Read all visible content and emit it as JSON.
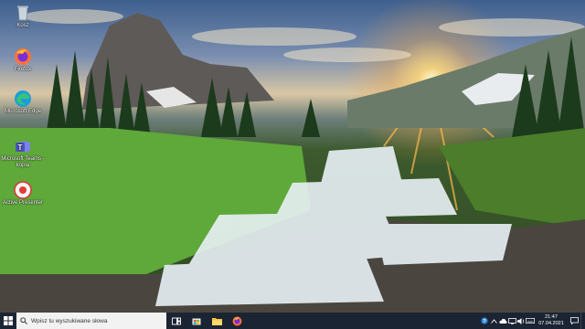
{
  "desktop": {
    "icons": [
      {
        "label": "Kosz",
        "icon": "recycle-bin-icon"
      },
      {
        "label": "Firefox",
        "icon": "firefox-icon"
      },
      {
        "label": "Microsoft Edge",
        "icon": "edge-icon"
      },
      {
        "label": "Microsoft Teams - kopia",
        "icon": "teams-icon"
      },
      {
        "label": "Active Presenter",
        "icon": "active-presenter-icon"
      }
    ]
  },
  "taskbar": {
    "search_placeholder": "Wpisz tu wyszukiwane słowa",
    "apps": [
      {
        "icon": "task-view-icon"
      },
      {
        "icon": "microsoft-store-icon"
      },
      {
        "icon": "file-explorer-icon"
      },
      {
        "icon": "firefox-icon"
      }
    ],
    "tray": {
      "icons": [
        "help-icon",
        "chevron-up-icon",
        "cloud-icon",
        "network-icon",
        "volume-icon",
        "keyboard-icon"
      ],
      "time": "21:47",
      "date": "07.04.2021"
    }
  },
  "colors": {
    "taskbar_bg": "#1b2433",
    "search_bg": "#f2f2f2"
  }
}
